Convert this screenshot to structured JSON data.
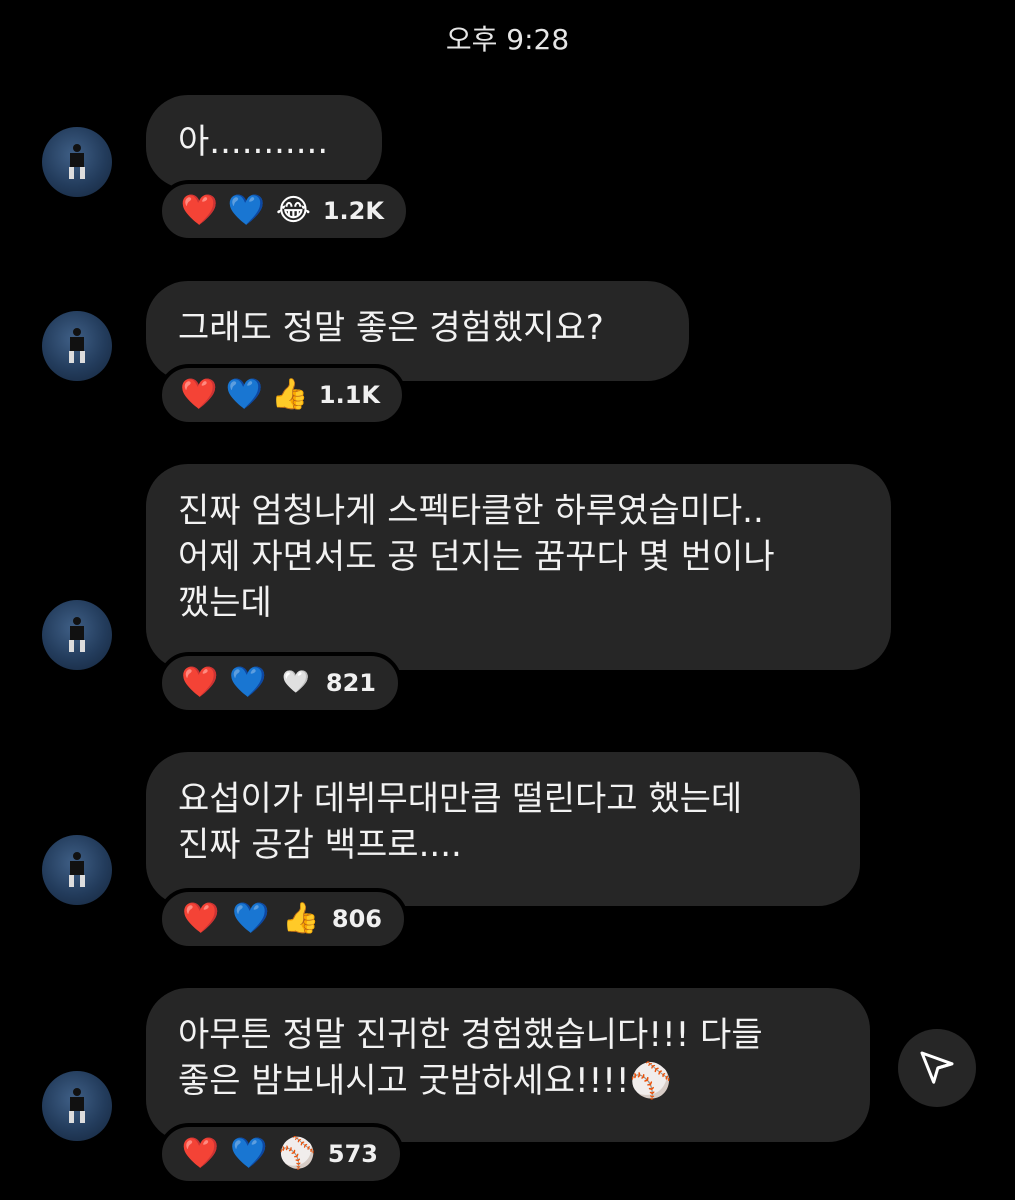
{
  "header": {
    "time": "오후 9:28"
  },
  "messages": [
    {
      "lines": [
        "아..........."
      ],
      "reactions": {
        "emojis": [
          "❤️",
          "💙",
          "😂"
        ],
        "count": "1.2K"
      }
    },
    {
      "lines": [
        "그래도 정말 좋은 경험했지요?"
      ],
      "reactions": {
        "emojis": [
          "❤️",
          "💙",
          "👍"
        ],
        "count": "1.1K"
      }
    },
    {
      "lines": [
        "진짜 엄청나게 스펙타클한 하루였습미다..",
        "어제 자면서도 공 던지는 꿈꾸다 몇 번이나",
        "깼는데"
      ],
      "reactions": {
        "emojis": [
          "❤️",
          "💙",
          "🤍"
        ],
        "count": "821"
      }
    },
    {
      "lines": [
        "요섭이가 데뷔무대만큼 떨린다고 했는데",
        "진짜 공감 백프로...."
      ],
      "reactions": {
        "emojis": [
          "❤️",
          "💙",
          "👍"
        ],
        "count": "806"
      }
    },
    {
      "lines": [
        "아무튼 정말 진귀한 경험했습니다!!! 다들",
        "좋은 밤보내시고 굿밤하세요!!!!⚾"
      ],
      "reactions": {
        "emojis": [
          "❤️",
          "💙",
          "⚾"
        ],
        "count": "573"
      }
    }
  ],
  "actions": {
    "share_icon": "send-icon"
  }
}
